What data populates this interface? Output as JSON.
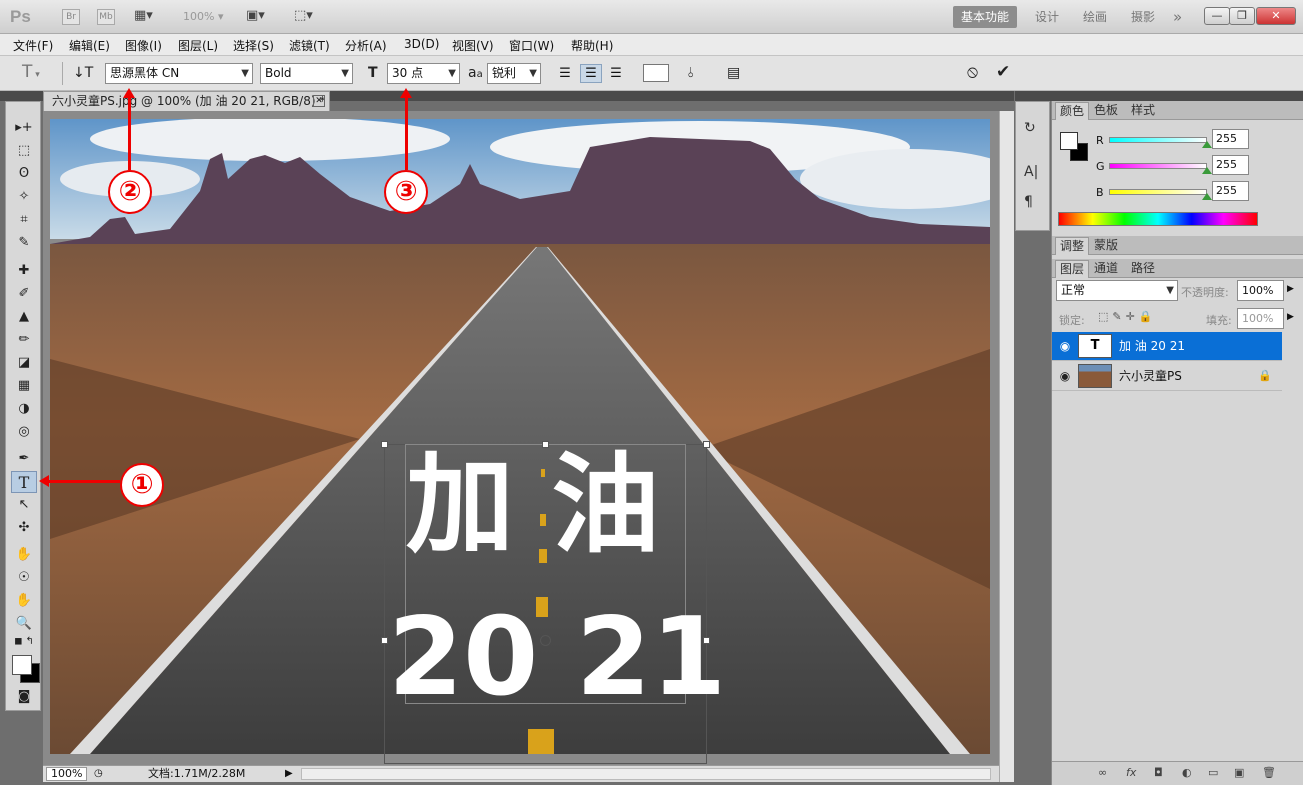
{
  "app": {
    "logo": "Ps",
    "zoom": "100%"
  },
  "titlebar": {
    "btn_br": "Br",
    "btn_mb": "Mb",
    "workspaces": [
      "基本功能",
      "设计",
      "绘画",
      "摄影"
    ],
    "more": "»",
    "window_controls": {
      "minimize": "—",
      "restore": "❐",
      "close": "✕"
    }
  },
  "menu": [
    "文件(F)",
    "编辑(E)",
    "图像(I)",
    "图层(L)",
    "选择(S)",
    "滤镜(T)",
    "分析(A)",
    "3D(D)",
    "视图(V)",
    "窗口(W)",
    "帮助(H)"
  ],
  "options": {
    "tool_glyph": "T",
    "font_family": "思源黑体 CN",
    "font_style": "Bold",
    "font_size": "30 点",
    "aa_label": "a",
    "anti_alias": "锐利",
    "cancel": "⦸",
    "commit": "✔"
  },
  "document": {
    "tab_title": "六小灵童PS.jpg @ 100% (加 油 20 21, RGB/8) *",
    "close": "✕",
    "text_line1": "加 油",
    "text_line2": "20 21"
  },
  "tools": [
    "▸+",
    "⬚",
    "ʘ",
    "✧",
    "⌗",
    "✎",
    "✚",
    "✐",
    "▲",
    "✏",
    "◪",
    "▦",
    "◑",
    "◎",
    "✒",
    "T",
    "↖",
    "✣",
    "✋",
    "☉",
    "✋",
    "🔍"
  ],
  "status": {
    "zoom": "100%",
    "doc": "文档:1.71M/2.28M"
  },
  "color_panel": {
    "tabs": [
      "颜色",
      "色板",
      "样式"
    ],
    "channels": [
      {
        "label": "R",
        "value": "255",
        "color": "#00e0e0"
      },
      {
        "label": "G",
        "value": "255",
        "color": "#e000e0"
      },
      {
        "label": "B",
        "value": "255",
        "color": "#e0e000"
      }
    ]
  },
  "adjust_tabs": [
    "调整",
    "蒙版"
  ],
  "layers_panel": {
    "tabs": [
      "图层",
      "通道",
      "路径"
    ],
    "blend_mode": "正常",
    "opacity_label": "不透明度:",
    "opacity": "100%",
    "lock_label": "锁定:",
    "fill_label": "填充:",
    "fill": "100%",
    "layers": [
      {
        "name": "加 油 20 21",
        "thumb": "T",
        "selected": true
      },
      {
        "name": "六小灵童PS",
        "thumb": "",
        "selected": false
      }
    ],
    "footer_icons": [
      "∞",
      "fx",
      "◘",
      "◐",
      "▭",
      "▣",
      "🗑"
    ]
  },
  "callouts": [
    "①",
    "②",
    "③"
  ],
  "side_icons": [
    "↻",
    "A|",
    "¶"
  ]
}
